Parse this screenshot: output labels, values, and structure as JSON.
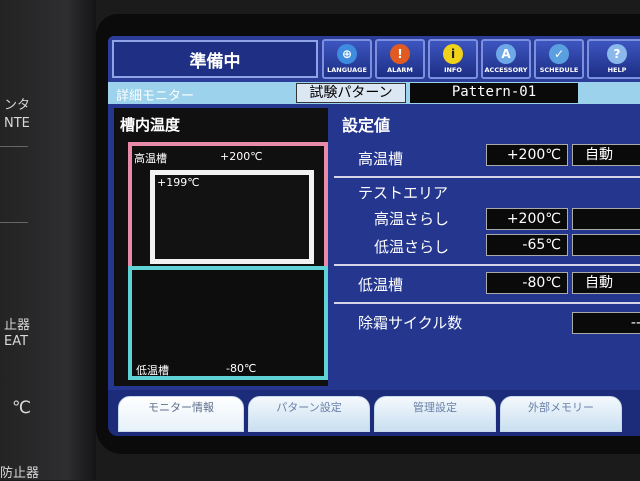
{
  "bezel": {
    "texts": [
      "ンタ",
      "NTE",
      "止器",
      "EAT",
      "℃",
      "防止器"
    ]
  },
  "header": {
    "status": "準備中",
    "buttons": [
      {
        "label": "LANGUAGE",
        "icon": "globe-icon",
        "color": "#3e8be0"
      },
      {
        "label": "ALARM",
        "icon": "alert-icon",
        "color": "#e05a22"
      },
      {
        "label": "INFO",
        "icon": "info-icon",
        "color": "#f0d21a"
      },
      {
        "label": "ACCESSORY",
        "icon": "accessory-icon",
        "color": "#6fa8e8"
      },
      {
        "label": "SCHEDULE",
        "icon": "check-icon",
        "color": "#5aa0e0"
      },
      {
        "label": "HELP",
        "icon": "help-icon",
        "color": "#8ab8ea"
      }
    ]
  },
  "subbar": {
    "title": "詳細モニター",
    "test_label": "試験パターン",
    "pattern": "Pattern-01"
  },
  "chamber": {
    "title": "槽内温度",
    "hot_label": "高温槽",
    "hot_temp": "+200℃",
    "test_temp": "+199℃",
    "cold_label": "低温槽",
    "cold_temp": "-80℃"
  },
  "settings": {
    "title": "設定値",
    "hot_label": "高温槽",
    "hot_value": "+200℃",
    "hot_mode": "自動",
    "test_area_label": "テストエリア",
    "hot_expose_label": "高温さらし",
    "hot_expose_value": "+200℃",
    "cold_expose_label": "低温さらし",
    "cold_expose_value": "-65℃",
    "cold_label": "低温槽",
    "cold_value": "-80℃",
    "cold_mode": "自動",
    "defrost_label": "除霜サイクル数",
    "defrost_value": "--"
  },
  "tabs": [
    "モニター情報",
    "パターン設定",
    "管理設定",
    "外部メモリー"
  ],
  "colors": {
    "screen_bg": "#24368e",
    "hot_frame": "#e88aa8",
    "cold_frame": "#5fd2d6"
  }
}
